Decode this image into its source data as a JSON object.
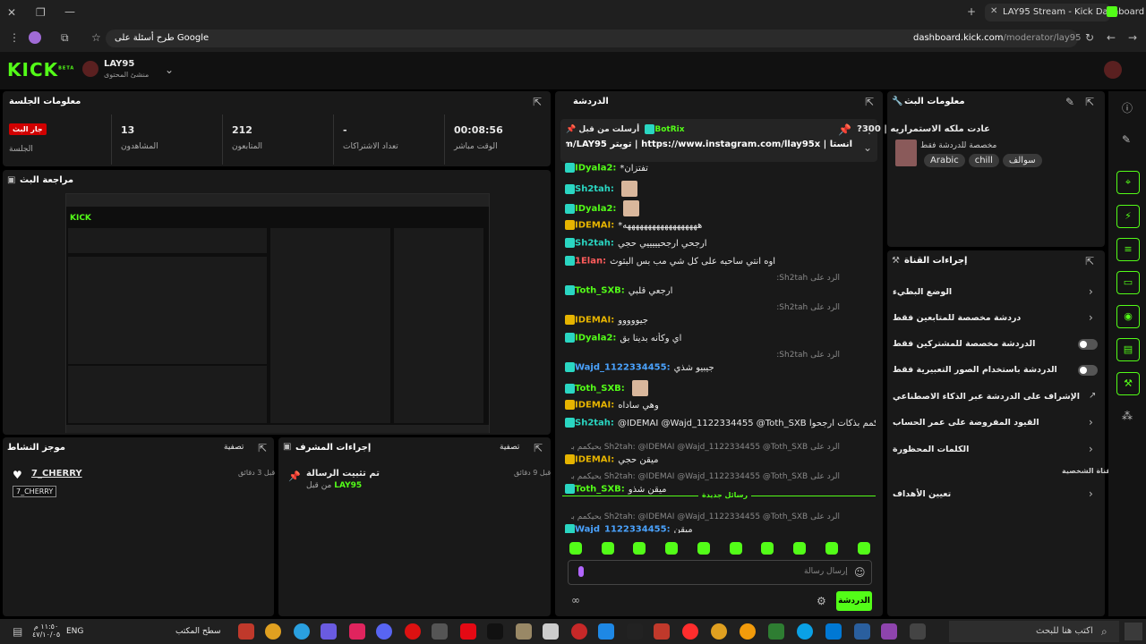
{
  "browser": {
    "tab_title": "LAY95 Stream - Kick Dashboard",
    "url_domain": "dashboard.kick.com",
    "url_path": "/moderator/lay95",
    "search_prompt": "طرح أسئلة على Google"
  },
  "app": {
    "logo": "KICK",
    "logo_sup": "BETA",
    "channel": "LAY95",
    "role": "منشئ المحتوى"
  },
  "session": {
    "title": "معلومات الجلسة",
    "live_badge": "جار البث",
    "live_label": "الجلسة",
    "viewers_value": "13",
    "viewers_label": "المشاهدون",
    "followers_value": "212",
    "followers_label": "المتابعون",
    "subs_value": "-",
    "subs_label": "تعداد الاشتراكات",
    "uptime_value": "00:08:56",
    "uptime_label": "الوقت مباشر"
  },
  "preview": {
    "title": "مراجعة البث"
  },
  "activity": {
    "title": "موجز النشاط",
    "filter": "تصفية",
    "user": "7_CHERRY",
    "time": "قبل 3 دقائق",
    "tooltip": "7_CHERRY"
  },
  "modactions": {
    "title": "إجراءات المشرف",
    "filter": "تصفية",
    "action": "تم تثبيت الرسالة",
    "by": "من قبل",
    "by_user": "LAY95",
    "time": "قبل 9 دقائق"
  },
  "chat": {
    "title": "الدردشة",
    "pinned_by": "أرسلت من قبل",
    "pinned_user": "BotRix",
    "pinned_text": "انستا | https://www.instagram.com/llay95x | تويتر https://x.com/LAY95_ | |",
    "new_messages": "رسائل جديدة",
    "input_placeholder": "إرسال رسالة",
    "send": "الدردشة",
    "messages": [
      {
        "user": "IDyala2:",
        "text": "*تفتزان",
        "color": "#53fc18"
      },
      {
        "user": "Sh2tah:",
        "text": "",
        "color": "#2ad6c2"
      },
      {
        "user": "IDyala2:",
        "text": "",
        "color": "#53fc18"
      },
      {
        "user": "IDEMAI:",
        "text": "*ههههههههههههههههههه",
        "color": "#e6b400"
      },
      {
        "user": "Sh2tah:",
        "text": "ارجحي ارجحيييييي حجي",
        "color": "#2ad6c2"
      },
      {
        "user": "1Elan:",
        "text": "اوه انتي ساحبه على كل شي مب بس البثوث",
        "color": "#ff5c5c"
      },
      {
        "user": "Toth_SXB:",
        "text": "ارجعي قلبي",
        "color": "#53fc18",
        "reply": "الرد على Sh2tah:"
      },
      {
        "user": "IDEMAI:",
        "text": "جيووووو",
        "color": "#e6b400",
        "reply": "الرد على Sh2tah:"
      },
      {
        "user": "IDyala2:",
        "text": "اي وكأنه بدينا بق",
        "color": "#53fc18"
      },
      {
        "user": "Wajd_1122334455:",
        "text": "جيبيو شذي",
        "color": "#4aa3ff",
        "reply": "الرد على Sh2tah:"
      },
      {
        "user": "Toth_SXB:",
        "text": "",
        "color": "#53fc18"
      },
      {
        "user": "IDEMAI:",
        "text": "وهي ساداه",
        "color": "#e6b400"
      },
      {
        "user": "Sh2tah:",
        "text": "@IDEMAI @Wajd_1122334455 @Toth_SXB يحيكمم بذكات ارجحوا",
        "color": "#2ad6c2"
      },
      {
        "user": "IDEMAI:",
        "text": "ميقن حجي",
        "color": "#e6b400",
        "reply": "الرد على Sh2tah: @IDEMAI @Wajd_1122334455 @Toth_SXB يحيكمم بذكات ارجحوا"
      },
      {
        "user": "Toth_SXB:",
        "text": "ميقن شذو",
        "color": "#53fc18",
        "reply": "الرد على Sh2tah: @IDEMAI @Wajd_1122334455 @Toth_SXB يحيكمم بذكات ارجحوا"
      },
      {
        "user": "Wajd_1122334455:",
        "text": "ميقن",
        "color": "#4aa3ff",
        "reply": "الرد على Sh2tah: @IDEMAI @Wajd_1122334455 @Toth_SXB يحيكمم بذكات ارجحوا"
      }
    ]
  },
  "streaminfo": {
    "title": "معلومات البث",
    "stream_title": "عادت ملكه الاستمراريه | 300?",
    "category": "مخصصة للدردشة فقط",
    "tags": [
      "سوالف",
      "chill",
      "Arabic"
    ]
  },
  "channelactions": {
    "title": "إجراءات القناة",
    "items": [
      "الوضع البطيء",
      "دردشة مخصصة للمتابعين فقط",
      "الدردشة مخصصة للمشتركين فقط",
      "الدردشة باستخدام الصور التعبيرية فقط",
      "الإشراف على الدردشة عبر الذكاء الاصطناعي",
      "القيود المفروضة على عمر الحساب",
      "الكلمات المحظورة"
    ],
    "section": "القناة الشخصية",
    "goals": "تعيين الأهداف"
  },
  "taskbar": {
    "search": "اكتب هنا للبحث",
    "lang": "ENG",
    "desktop": "سطح المكتب",
    "time": "١١:٥٠ م",
    "date": "٤٧/١٠/٠٥"
  }
}
